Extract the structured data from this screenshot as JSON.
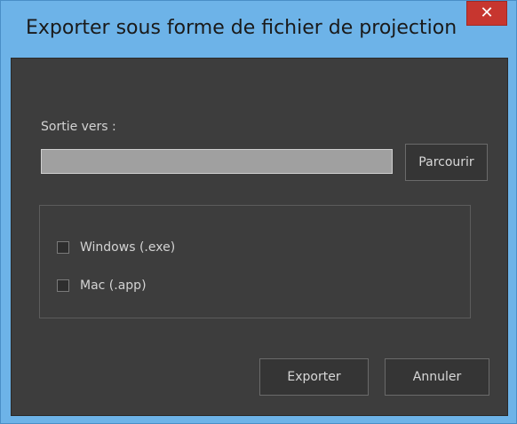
{
  "window": {
    "title": "Exporter sous forme de fichier de projection",
    "close_symbol": "✕"
  },
  "output": {
    "label": "Sortie vers :",
    "path_value": "",
    "browse_label": "Parcourir"
  },
  "platforms": [
    {
      "label": "Windows (.exe)",
      "checked": false
    },
    {
      "label": "Mac (.app)",
      "checked": false
    }
  ],
  "actions": {
    "export_label": "Exporter",
    "cancel_label": "Annuler"
  },
  "colors": {
    "titlebar": "#6db3e8",
    "close": "#c7362f",
    "panel": "#3d3d3d",
    "input": "#a0a0a0"
  }
}
